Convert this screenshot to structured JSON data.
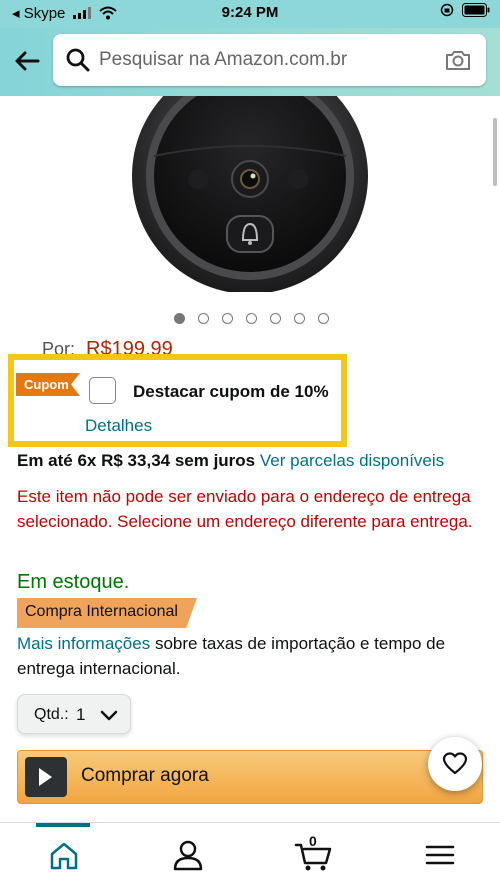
{
  "status_bar": {
    "carrier": "◂ Skype",
    "time": "9:24 PM"
  },
  "search": {
    "placeholder": "Pesquisar na Amazon.com.br"
  },
  "carousel": {
    "total_images": 7,
    "active_index": 0
  },
  "price": {
    "label": "Por:",
    "value": "R$199,99"
  },
  "coupon": {
    "badge": "Cupom",
    "text": "Destacar cupom de 10%",
    "details": "Detalhes",
    "checked": false
  },
  "installments": {
    "bold_text": "Em até 6x R$ 33,34 sem juros",
    "link": "Ver parcelas disponíveis"
  },
  "shipping_warning": "Este item não pode ser enviado para o endereço de entrega selecionado. Selecione um endereço diferente para entrega.",
  "stock_status": "Em estoque.",
  "international_badge": "Compra Internacional",
  "import_info": {
    "link": "Mais informações",
    "text": " sobre taxas de importação e tempo de entrega internacional."
  },
  "quantity": {
    "label": "Qtd.:",
    "value": "1"
  },
  "buy_now": {
    "label": "Comprar agora"
  },
  "bottom_nav": {
    "cart_count": "0",
    "items": [
      "home-icon",
      "account-icon",
      "cart-icon",
      "menu-icon"
    ]
  },
  "colors": {
    "header": "#8ed7d8",
    "link": "#007185",
    "price": "#b12704",
    "warning": "#c40000",
    "in_stock": "#007600",
    "coupon_highlight": "#f5c518",
    "buy_now": "#f2a541"
  }
}
